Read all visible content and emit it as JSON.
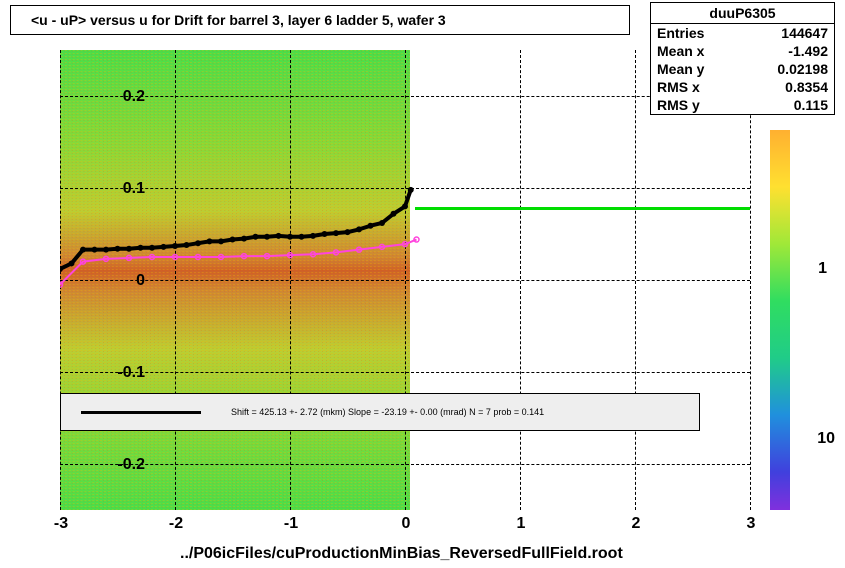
{
  "chart_data": {
    "type": "heatmap",
    "title": "<u - uP>      versus   u for Drift for barrel 3, layer 6 ladder 5, wafer 3",
    "xlabel": "",
    "ylabel": "",
    "xlim": [
      -3,
      3
    ],
    "ylim": [
      -0.25,
      0.25
    ],
    "xticks": [
      -3,
      -2,
      -1,
      0,
      1,
      2,
      3
    ],
    "yticks": [
      -0.2,
      -0.1,
      0,
      0.1,
      0.2
    ],
    "heatmap_x_range": [
      -3,
      0.1
    ],
    "heatmap_y_range": [
      -0.25,
      0.25
    ],
    "colorbar_labels": [
      "1",
      "10"
    ],
    "green_line_y": 0.078,
    "green_line_x_range": [
      0.1,
      3
    ],
    "series": [
      {
        "name": "black-profile",
        "color": "#000",
        "x": [
          -3.0,
          -2.9,
          -2.8,
          -2.7,
          -2.6,
          -2.5,
          -2.4,
          -2.3,
          -2.2,
          -2.1,
          -2.0,
          -1.9,
          -1.8,
          -1.7,
          -1.6,
          -1.5,
          -1.4,
          -1.3,
          -1.2,
          -1.1,
          -1.0,
          -0.9,
          -0.8,
          -0.7,
          -0.6,
          -0.5,
          -0.4,
          -0.3,
          -0.2,
          -0.1,
          0.0,
          0.05
        ],
        "y": [
          0.012,
          0.018,
          0.033,
          0.033,
          0.033,
          0.034,
          0.034,
          0.035,
          0.035,
          0.036,
          0.037,
          0.038,
          0.04,
          0.042,
          0.042,
          0.044,
          0.045,
          0.047,
          0.047,
          0.048,
          0.047,
          0.047,
          0.048,
          0.05,
          0.051,
          0.052,
          0.055,
          0.059,
          0.062,
          0.072,
          0.08,
          0.098
        ]
      },
      {
        "name": "magenta-profile",
        "color": "#ff44dd",
        "x": [
          -3.0,
          -2.8,
          -2.6,
          -2.4,
          -2.2,
          -2.0,
          -1.8,
          -1.6,
          -1.4,
          -1.2,
          -1.0,
          -0.8,
          -0.6,
          -0.4,
          -0.2,
          0.0,
          0.1
        ],
        "y": [
          -0.005,
          0.02,
          0.023,
          0.024,
          0.025,
          0.025,
          0.025,
          0.025,
          0.026,
          0.026,
          0.027,
          0.028,
          0.03,
          0.033,
          0.036,
          0.039,
          0.044
        ]
      }
    ],
    "fit_text": "Shift =   425.13 +- 2.72 (mkm) Slope =   -23.19 +- 0.00 (mrad)  N = 7 prob = 0.141"
  },
  "stats": {
    "name": "duuP6305",
    "entries_label": "Entries",
    "entries": "144647",
    "meanx_label": "Mean x",
    "meanx": "-1.492",
    "meany_label": "Mean y",
    "meany": "0.02198",
    "rmsx_label": "RMS x",
    "rmsx": "0.8354",
    "rmsy_label": "RMS y",
    "rmsy": "0.115"
  },
  "bottom_path": "../P06icFiles/cuProductionMinBias_ReversedFullField.root",
  "yticks": {
    "t0": "-0.2",
    "t1": "-0.1",
    "t2": "0",
    "t3": "0.1",
    "t4": "0.2"
  },
  "xticks": {
    "t0": "-3",
    "t1": "-2",
    "t2": "-1",
    "t3": "0",
    "t4": "1",
    "t5": "2",
    "t6": "3"
  },
  "cb": {
    "l1": "1",
    "l2": "10"
  }
}
